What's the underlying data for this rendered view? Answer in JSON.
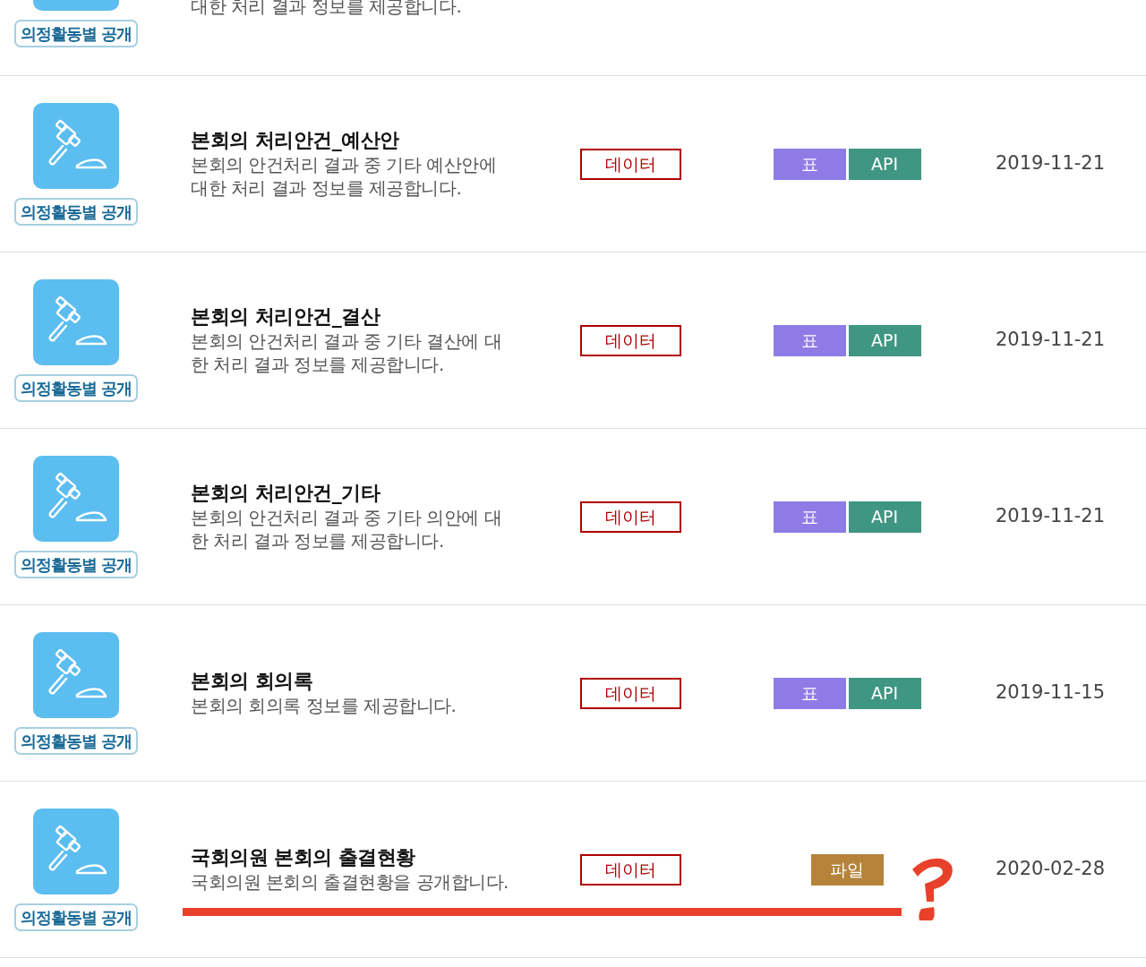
{
  "rows": [
    {
      "tag": "의정활동별 공개",
      "description_lines": [
        "대한 처리 결과 정보를 제공합니다."
      ],
      "partial": true
    },
    {
      "tag": "의정활동별 공개",
      "title": "본회의 처리안건_예산안",
      "description_lines": [
        "본회의 안건처리 결과 중 기타 예산안에",
        "대한 처리 결과 정보를 제공합니다."
      ],
      "type_badge": "데이터",
      "formats": [
        {
          "kind": "table",
          "label": "표"
        },
        {
          "kind": "api",
          "label": "API"
        }
      ],
      "date": "2019-11-21"
    },
    {
      "tag": "의정활동별 공개",
      "title": "본회의 처리안건_결산",
      "description_lines": [
        "본회의 안건처리 결과 중 기타 결산에 대",
        "한 처리 결과 정보를 제공합니다."
      ],
      "type_badge": "데이터",
      "formats": [
        {
          "kind": "table",
          "label": "표"
        },
        {
          "kind": "api",
          "label": "API"
        }
      ],
      "date": "2019-11-21"
    },
    {
      "tag": "의정활동별 공개",
      "title": "본회의 처리안건_기타",
      "description_lines": [
        "본회의 안건처리 결과 중 기타 의안에 대",
        "한 처리 결과 정보를 제공합니다."
      ],
      "type_badge": "데이터",
      "formats": [
        {
          "kind": "table",
          "label": "표"
        },
        {
          "kind": "api",
          "label": "API"
        }
      ],
      "date": "2019-11-21"
    },
    {
      "tag": "의정활동별 공개",
      "title": "본회의 회의록",
      "description_lines": [
        "본회의 회의록 정보를 제공합니다."
      ],
      "type_badge": "데이터",
      "formats": [
        {
          "kind": "table",
          "label": "표"
        },
        {
          "kind": "api",
          "label": "API"
        }
      ],
      "date": "2019-11-15"
    },
    {
      "tag": "의정활동별 공개",
      "title": "국회의원 본회의 출결현황",
      "description_lines": [
        "국회의원 본회의 출결현황을 공개합니다."
      ],
      "type_badge": "데이터",
      "formats": [
        {
          "kind": "file",
          "label": "파일"
        }
      ],
      "date": "2020-02-28",
      "underline": {
        "color": "#e8412b"
      },
      "question_mark": {
        "color": "#e8412b"
      }
    }
  ]
}
